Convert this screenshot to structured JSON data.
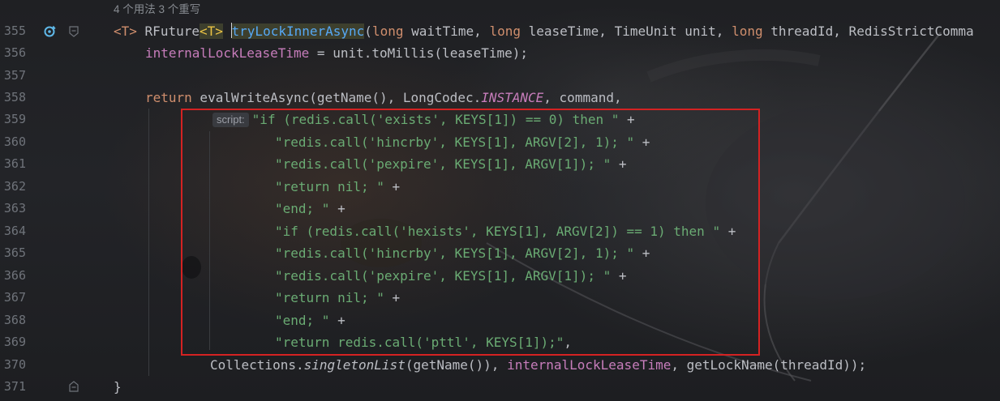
{
  "hint": "4 个用法   3 个重写",
  "line_numbers": [
    "355",
    "356",
    "357",
    "358",
    "359",
    "360",
    "361",
    "362",
    "363",
    "364",
    "365",
    "366",
    "367",
    "368",
    "369",
    "370",
    "371"
  ],
  "code": {
    "l355": {
      "t_open": "<T>",
      "rfuture": "RFuture",
      "t_generic": "<T>",
      "method": "tryLockInnerAsync",
      "params_p1": "(",
      "long1": "long",
      "p_wait": " waitTime, ",
      "long2": "long",
      "p_lease": " leaseTime, TimeUnit unit, ",
      "long3": "long",
      "p_thread": " threadId, RedisStrictComma"
    },
    "l356": {
      "field": "internalLockLeaseTime",
      "rest": " = unit.toMillis(leaseTime);"
    },
    "l358": {
      "kw_return": "return",
      "call": " evalWriteAsync(getName(), LongCodec.",
      "instance": "INSTANCE",
      "tail": ", command,"
    },
    "l359": {
      "inlay": "script:",
      "str": "\"if (redis.call('exists', KEYS[1]) == 0) then \"",
      "op": " +"
    },
    "l360": {
      "str": "\"redis.call('hincrby', KEYS[1], ARGV[2], 1); \"",
      "op": " +"
    },
    "l361": {
      "str": "\"redis.call('pexpire', KEYS[1], ARGV[1]); \"",
      "op": " +"
    },
    "l362": {
      "str": "\"return nil; \"",
      "op": " +"
    },
    "l363": {
      "str": "\"end; \"",
      "op": " +"
    },
    "l364": {
      "str": "\"if (redis.call('hexists', KEYS[1], ARGV[2]) == 1) then \"",
      "op": " +"
    },
    "l365": {
      "str": "\"redis.call('hincrby', KEYS[1], ARGV[2], 1); \"",
      "op": " +"
    },
    "l366": {
      "str": "\"redis.call('pexpire', KEYS[1], ARGV[1]); \"",
      "op": " +"
    },
    "l367": {
      "str": "\"return nil; \"",
      "op": " +"
    },
    "l368": {
      "str": "\"end; \"",
      "op": " +"
    },
    "l369": {
      "str": "\"return redis.call('pttl', KEYS[1]);\"",
      "op": ","
    },
    "l370": {
      "collections": "Collections.",
      "singleton": "singletonList",
      "args1": "(getName()), ",
      "field": "internalLockLeaseTime",
      "args2": ", getLockName(threadId));"
    },
    "l371": {
      "brace": "}"
    }
  },
  "colors": {
    "background": "#1e1f22",
    "keyword": "#cf8e6d",
    "string": "#6aab73",
    "field": "#c77dbb",
    "method": "#56a8f5",
    "highlight_box": "#d42222"
  },
  "icons": [
    "implementation-marker-icon",
    "fold-icon",
    "fold-end-icon"
  ]
}
